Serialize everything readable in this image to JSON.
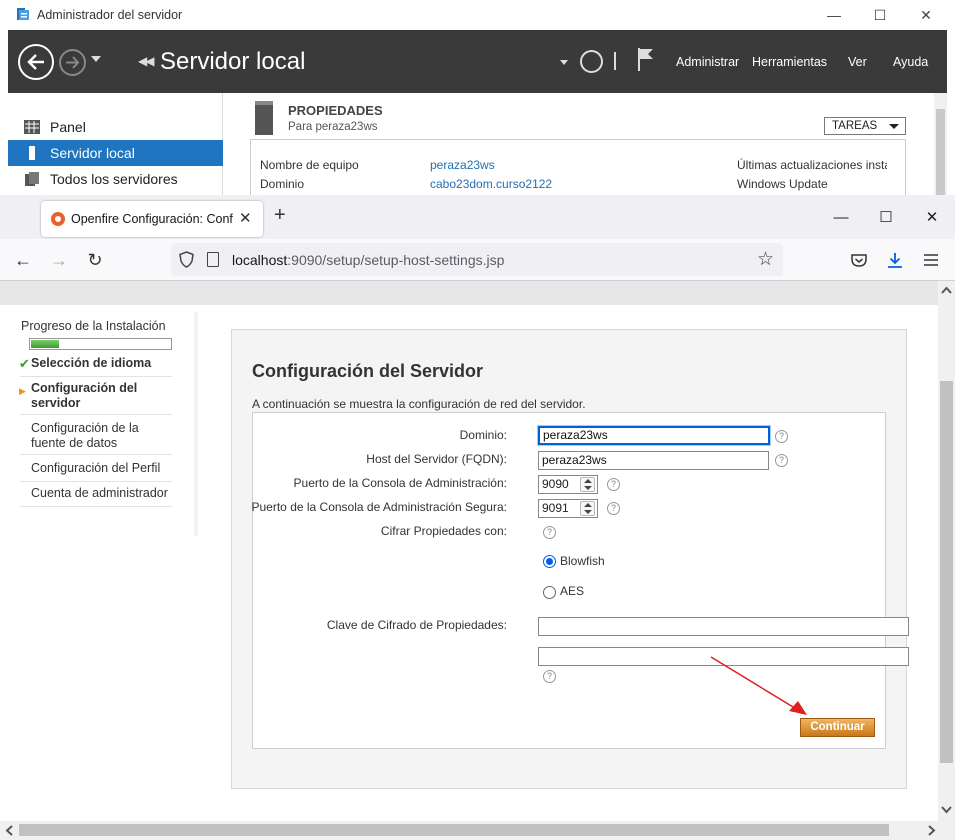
{
  "server_manager": {
    "window_title": "Administrador del servidor",
    "breadcrumb_title": "Servidor local",
    "menu": [
      "Administrar",
      "Herramientas",
      "Ver",
      "Ayuda"
    ],
    "nav": [
      {
        "label": "Panel",
        "active": false
      },
      {
        "label": "Servidor local",
        "active": true
      },
      {
        "label": "Todos los servidores",
        "active": false
      }
    ],
    "properties": {
      "title": "PROPIEDADES",
      "subtitle": "Para peraza23ws",
      "tasks_label": "TAREAS",
      "rows": [
        {
          "key": "Nombre de equipo",
          "value": "peraza23ws",
          "right": "Últimas actualizaciones insta"
        },
        {
          "key": "Dominio",
          "value": "cabo23dom.curso2122",
          "right": "Windows Update"
        }
      ]
    }
  },
  "browser": {
    "tab_title": "Openfire Configuración: Confi",
    "url_host": "localhost",
    "url_rest": ":9090/setup/setup-host-settings.jsp"
  },
  "sidebar": {
    "progress_label": "Progreso de la Instalación",
    "progress_fraction": 0.2,
    "steps": [
      {
        "label": "Selección de idioma",
        "state": "done"
      },
      {
        "label": "Configuración del servidor",
        "state": "current"
      },
      {
        "label": "Configuración de la fuente de datos",
        "state": "todo"
      },
      {
        "label": "Configuración del Perfil",
        "state": "todo"
      },
      {
        "label": "Cuenta de administrador",
        "state": "todo"
      }
    ]
  },
  "main": {
    "title": "Configuración del Servidor",
    "intro": "A continuación se muestra la configuración de red del servidor.",
    "fields": {
      "domain_label": "Dominio:",
      "domain_value": "peraza23ws",
      "host_label": "Host del Servidor (FQDN):",
      "host_value": "peraza23ws",
      "admin_port_label": "Puerto de la Consola de Administración:",
      "admin_port_value": "9090",
      "secure_port_label": "Puerto de la Consola de Administración Segura:",
      "secure_port_value": "9091",
      "encrypt_label": "Cifrar Propiedades con:",
      "options": [
        {
          "label": "Blowfish",
          "selected": true
        },
        {
          "label": "AES",
          "selected": false
        }
      ],
      "key_label": "Clave de Cifrado de Propiedades:",
      "key_value": "",
      "key_confirm_value": ""
    },
    "continue_label": "Continuar",
    "help_glyph": "?"
  },
  "colors": {
    "accent_blue": "#1f75c0",
    "continue_button": "#d88a28",
    "annotation_arrow": "#e01f1f"
  }
}
